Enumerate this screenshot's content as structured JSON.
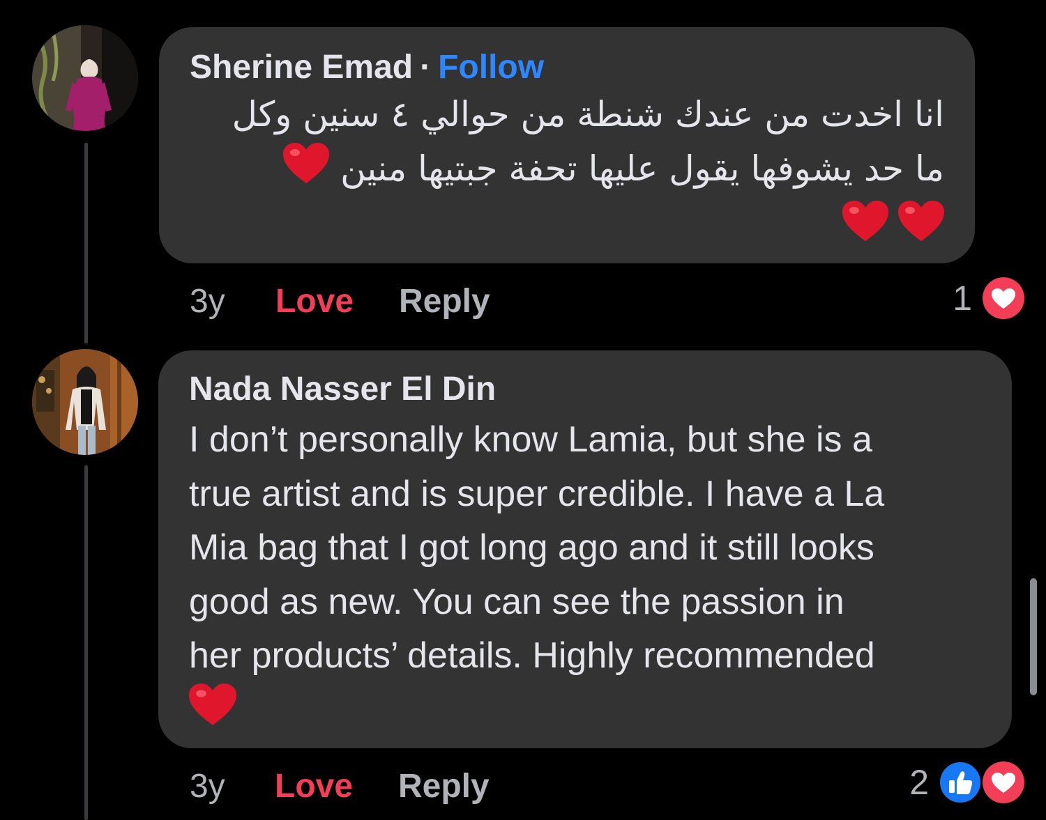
{
  "comments": [
    {
      "author": "Sherine Emad",
      "separator": "·",
      "follow_label": "Follow",
      "text_line_1": "انا اخدت من عندك شنطة من حوالي ٤ سنين وكل",
      "text_line_2": "ما حد يشوفها يقول عليها تحفة جبتيها منين",
      "time": "3y",
      "love_label": "Love",
      "reply_label": "Reply",
      "reaction_count": "1",
      "reactions": [
        "love-reaction-icon"
      ]
    },
    {
      "author": "Nada Nasser El Din",
      "text_lines": [
        "I don’t personally know Lamia, but she is a",
        "true artist and is super credible. I have a La",
        "Mia bag that I got long ago and it still looks",
        "good as new. You can see the passion in",
        "her products’ details. Highly recommended"
      ],
      "time": "3y",
      "love_label": "Love",
      "reply_label": "Reply",
      "reaction_count": "2",
      "reactions": [
        "like-reaction-icon",
        "love-reaction-icon"
      ]
    }
  ],
  "colors": {
    "background": "#000000",
    "bubble": "#333334",
    "follow": "#2d88ff",
    "love": "#f33e58",
    "like": "#1877f2",
    "heart": "#e0172c"
  }
}
